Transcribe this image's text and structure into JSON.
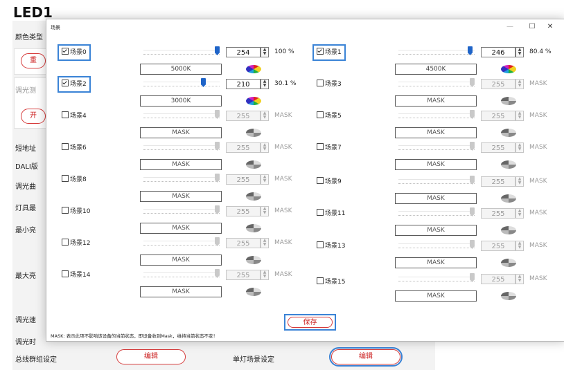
{
  "app": {
    "title": "LED1"
  },
  "background": {
    "labels": [
      "颜色类型",
      "短地址",
      "DALI版",
      "调光曲",
      "灯具最",
      "最小亮",
      "最大亮",
      "调光速",
      "调光时",
      "总线群组设定",
      "单灯场景设定"
    ],
    "bus_group_button": "编辑",
    "single_scene_button": "编辑",
    "fragment_buttons": [
      "重",
      "开"
    ],
    "fragment_labels": [
      "调光测"
    ]
  },
  "dialog": {
    "title": "场景",
    "minimize": "—",
    "maximize": "☐",
    "close": "✕",
    "save_label": "保存",
    "footnote": "MASK: 表示此项不影响该设备的当前状态，即设备收到Mask，维持当前状态不变！",
    "scenes": [
      {
        "label": "场景0",
        "checked": true,
        "value": "254",
        "percent": "100 %",
        "color_temp": "5000K",
        "level": 1.0
      },
      {
        "label": "场景1",
        "checked": true,
        "value": "246",
        "percent": "80.4 %",
        "color_temp": "4500K",
        "level": 0.97
      },
      {
        "label": "场景2",
        "checked": true,
        "value": "210",
        "percent": "30.1 %",
        "color_temp": "3000K",
        "level": 0.82
      },
      {
        "label": "场景3",
        "checked": false,
        "value": "255",
        "percent": "MASK",
        "color_temp": "MASK",
        "level": 1.0
      },
      {
        "label": "场景4",
        "checked": false,
        "value": "255",
        "percent": "MASK",
        "color_temp": "MASK",
        "level": 1.0
      },
      {
        "label": "场景5",
        "checked": false,
        "value": "255",
        "percent": "MASK",
        "color_temp": "MASK",
        "level": 1.0
      },
      {
        "label": "场景6",
        "checked": false,
        "value": "255",
        "percent": "MASK",
        "color_temp": "MASK",
        "level": 1.0
      },
      {
        "label": "场景7",
        "checked": false,
        "value": "255",
        "percent": "MASK",
        "color_temp": "MASK",
        "level": 1.0
      },
      {
        "label": "场景8",
        "checked": false,
        "value": "255",
        "percent": "MASK",
        "color_temp": "MASK",
        "level": 1.0
      },
      {
        "label": "场景9",
        "checked": false,
        "value": "255",
        "percent": "MASK",
        "color_temp": "MASK",
        "level": 1.0
      },
      {
        "label": "场景10",
        "checked": false,
        "value": "255",
        "percent": "MASK",
        "color_temp": "MASK",
        "level": 1.0
      },
      {
        "label": "场景11",
        "checked": false,
        "value": "255",
        "percent": "MASK",
        "color_temp": "MASK",
        "level": 1.0
      },
      {
        "label": "场景12",
        "checked": false,
        "value": "255",
        "percent": "MASK",
        "color_temp": "MASK",
        "level": 1.0
      },
      {
        "label": "场景13",
        "checked": false,
        "value": "255",
        "percent": "MASK",
        "color_temp": "MASK",
        "level": 1.0
      },
      {
        "label": "场景14",
        "checked": false,
        "value": "255",
        "percent": "MASK",
        "color_temp": "MASK",
        "level": 1.0
      },
      {
        "label": "场景15",
        "checked": false,
        "value": "255",
        "percent": "MASK",
        "color_temp": "MASK",
        "level": 1.0
      }
    ]
  },
  "colors": {
    "accent": "#3a83d6",
    "danger": "#d63a3a",
    "slider_thumb": "#1f64c8"
  }
}
